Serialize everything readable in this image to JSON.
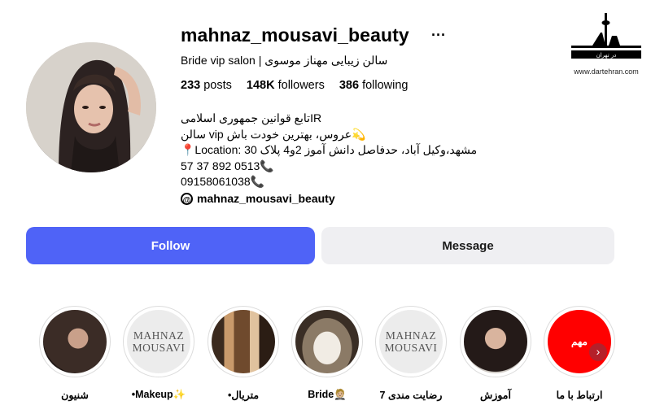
{
  "profile": {
    "username": "mahnaz_mousavi_beauty",
    "subtitle": "Bride vip salon | سالن زیبایی مهناز موسوی",
    "stats": {
      "posts_value": "233",
      "posts_label": "posts",
      "followers_value": "148K",
      "followers_label": "followers",
      "following_value": "386",
      "following_label": "following"
    },
    "bio": [
      "تابع قوانین جمهوری اسلامیIR",
      "سالن vip عروس، بهترین خودت باش💫",
      "📍Location: مشهد،وکیل آباد، حدفاصل دانش آموز 2و4 پلاک 30",
      "57 37 892 0513📞",
      "09158061038📞"
    ],
    "threads_handle": "mahnaz_mousavi_beauty"
  },
  "buttons": {
    "follow": "Follow",
    "message": "Message"
  },
  "highlights": [
    {
      "label": "شنیون",
      "kind": "photo",
      "color": "#3b2c26"
    },
    {
      "label": "•Makeup✨",
      "kind": "brand",
      "brand": [
        "MAHNAZ",
        "MOUSAVI"
      ]
    },
    {
      "label": "•متریال",
      "kind": "photo",
      "color": "#6f4a2d"
    },
    {
      "label": "Bride🤵🏼",
      "kind": "photo",
      "color": "#c7bba8"
    },
    {
      "label": "رضایت مندی 7",
      "kind": "brand",
      "brand": [
        "MAHNAZ",
        "MOUSAVI"
      ]
    },
    {
      "label": "آموزش",
      "kind": "photo",
      "color": "#241a18"
    },
    {
      "label": "ارتباط با ما",
      "kind": "red",
      "text": "مهم",
      "color": "#ff0000"
    }
  ],
  "watermark": {
    "logo_text": "در تهران",
    "url": "www.dartehran.com"
  },
  "colors": {
    "follow": "#4f63f7",
    "message": "#efeff2"
  }
}
